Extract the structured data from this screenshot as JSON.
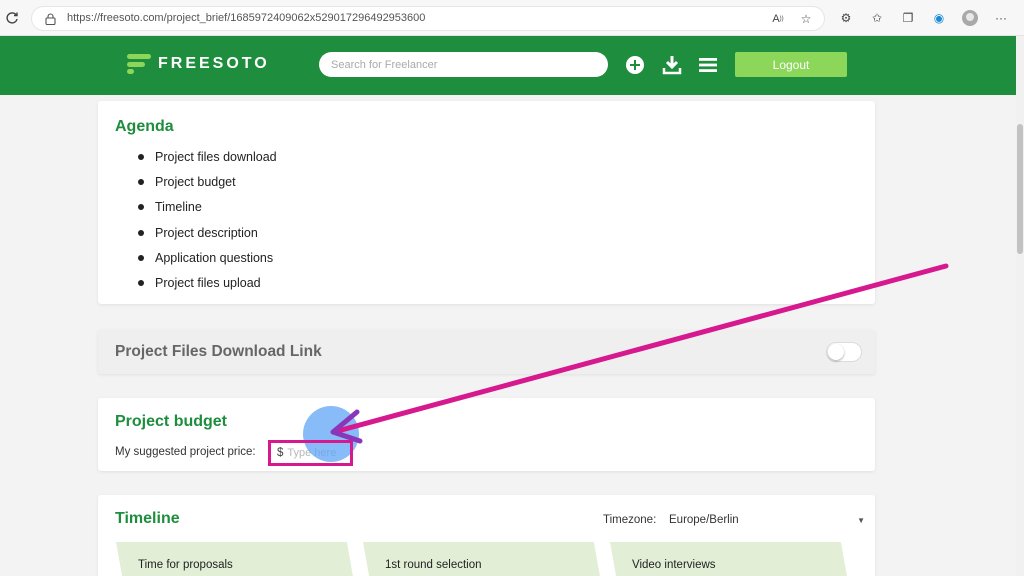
{
  "browser": {
    "url": "https://freesoto.com/project_brief/1685972409062x529017296492953600"
  },
  "header": {
    "logo_text": "FREESOTO",
    "search_placeholder": "Search for Freelancer",
    "logout_label": "Logout"
  },
  "agenda": {
    "title": "Agenda",
    "items": [
      "Project files download",
      "Project budget",
      "Timeline",
      "Project description",
      "Application questions",
      "Project files upload"
    ]
  },
  "download": {
    "title": "Project Files Download Link",
    "enabled": false
  },
  "budget": {
    "title": "Project budget",
    "label": "My suggested project price:",
    "currency": "$",
    "placeholder": "Type here"
  },
  "timeline": {
    "title": "Timeline",
    "timezone_label": "Timezone:",
    "timezone_value": "Europe/Berlin",
    "steps": [
      "Time for proposals",
      "1st round selection",
      "Video interviews"
    ]
  },
  "colors": {
    "brand_green": "#1e8e3e",
    "accent_green": "#8cd65a",
    "annotation_magenta": "#d6198e"
  }
}
